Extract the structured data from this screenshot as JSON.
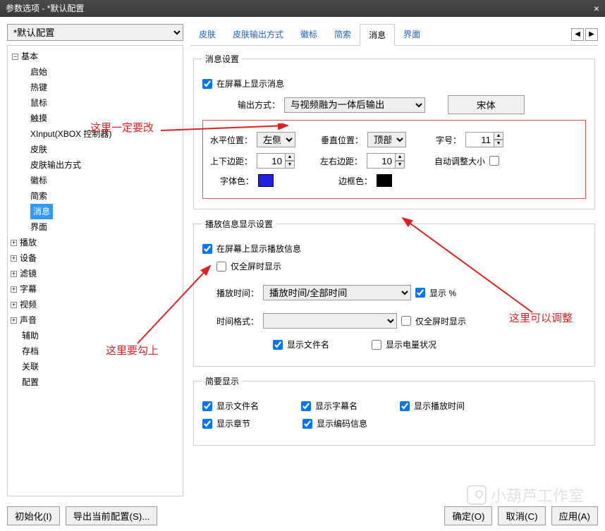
{
  "window": {
    "title": "参数选项 - *默认配置",
    "close": "×"
  },
  "config_selector": {
    "value": "*默认配置"
  },
  "tree": {
    "basic": {
      "label": "基本",
      "children": [
        "启始",
        "热键",
        "鼠标",
        "触摸",
        "XInput(XBOX 控制器)",
        "皮肤",
        "皮肤输出方式",
        "徽标",
        "简索",
        "消息",
        "界面"
      ]
    },
    "collapsed": [
      "播放",
      "设备",
      "滤镜",
      "字幕",
      "视频",
      "声音"
    ],
    "leaf": [
      "辅助",
      "存档",
      "关联",
      "配置"
    ]
  },
  "tabs": {
    "items": [
      "皮肤",
      "皮肤输出方式",
      "徽标",
      "简索",
      "消息",
      "界面"
    ],
    "active": 4,
    "left": "◀",
    "right": "▶"
  },
  "msg_settings": {
    "legend": "消息设置",
    "show_on_screen": "在屏幕上显示消息",
    "output_mode_label": "输出方式：",
    "output_mode_value": "与视频融为一体后输出",
    "font_button": "宋体",
    "hpos_label": "水平位置：",
    "hpos_value": "左侧",
    "vpos_label": "垂直位置：",
    "vpos_value": "顶部",
    "fontsize_label": "字号：",
    "fontsize_value": "11",
    "vmargin_label": "上下边距：",
    "vmargin_value": "10",
    "hmargin_label": "左右边距：",
    "hmargin_value": "10",
    "autosize_label": "自动调整大小",
    "fontcolor_label": "字体色：",
    "fontcolor_value": "#2020e0",
    "bordercolor_label": "边框色：",
    "bordercolor_value": "#000000"
  },
  "playback_info": {
    "legend": "播放信息显示设置",
    "show_on_screen": "在屏幕上显示播放信息",
    "only_fullscreen": "仅全屏时显示",
    "playtime_label": "播放时间：",
    "playtime_value": "播放时间/全部时间",
    "show_percent": "显示 %",
    "timefmt_label": "时间格式：",
    "timefmt_value": "",
    "only_fullscreen2": "仅全屏时显示",
    "show_filename": "显示文件名",
    "show_battery": "显示电量状况"
  },
  "brief": {
    "legend": "简要显示",
    "show_filename": "显示文件名",
    "show_subtitle": "显示字幕名",
    "show_playtime": "显示播放时间",
    "show_chapter": "显示章节",
    "show_codec": "显示编码信息"
  },
  "annotations": {
    "a1": "这里一定要改",
    "a2": "这里要勾上",
    "a3": "这里可以调整"
  },
  "footer": {
    "init": "初始化(I)",
    "export": "导出当前配置(S)...",
    "ok": "确定(O)",
    "cancel": "取消(C)",
    "apply": "应用(A)"
  },
  "watermark": "小葫芦工作室"
}
